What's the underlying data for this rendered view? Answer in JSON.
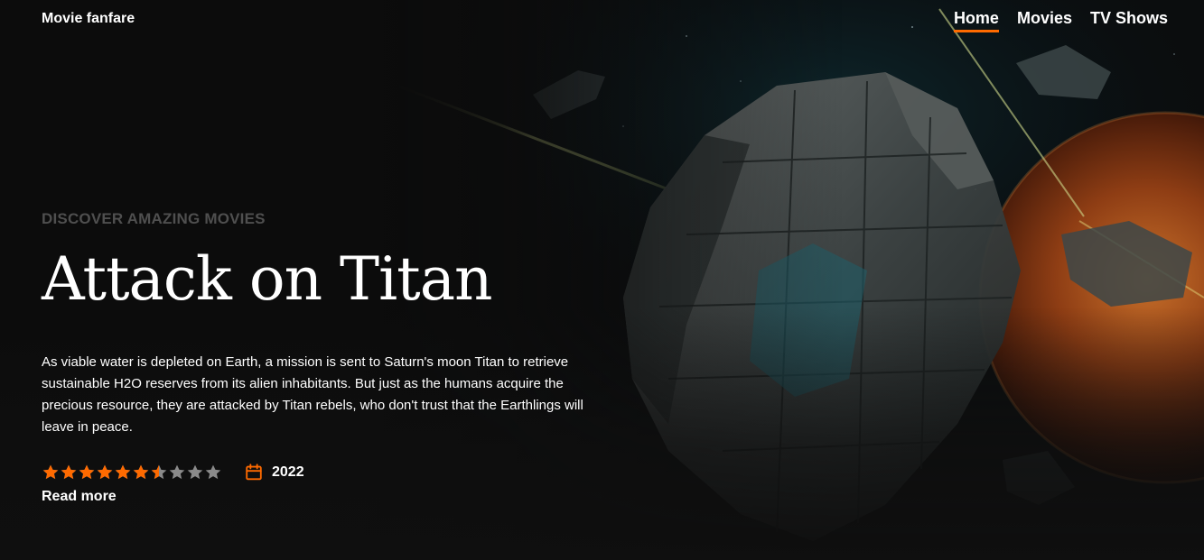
{
  "brand": "Movie fanfare",
  "nav": {
    "items": [
      {
        "label": "Home",
        "active": true
      },
      {
        "label": "Movies",
        "active": false
      },
      {
        "label": "TV Shows",
        "active": false
      }
    ]
  },
  "hero": {
    "eyebrow": "DISCOVER AMAZING MOVIES",
    "title": "Attack on Titan",
    "description": "As viable water is depleted on Earth, a mission is sent to Saturn's moon Titan to retrieve sustainable H2O reserves from its alien inhabitants. But just as the humans acquire the precious resource, they are attacked by Titan rebels, who don't trust that the Earthlings will leave in peace.",
    "rating": {
      "value": 6.5,
      "max": 10
    },
    "year": "2022",
    "read_more": "Read more",
    "background_icon": "spaceship-scene"
  },
  "colors": {
    "accent": "#ff6a00",
    "background": "#0f0f0f",
    "eyebrow": "#4f4f4f",
    "star_inactive": "#8a8a8a"
  }
}
